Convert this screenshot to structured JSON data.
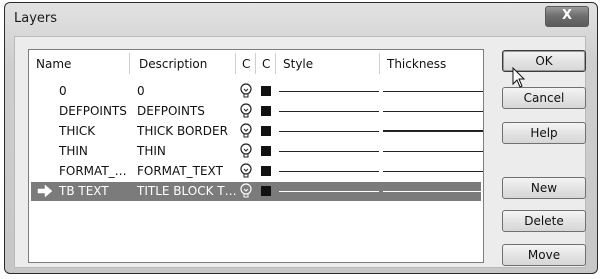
{
  "window": {
    "title": "Layers",
    "close_label": "X"
  },
  "columns": [
    "Name",
    "Description",
    "C",
    "C",
    "Style",
    "Thickness"
  ],
  "rows": [
    {
      "name": "0",
      "description": "0",
      "selected": false,
      "thick": false
    },
    {
      "name": "DEFPOINTS",
      "description": "DEFPOINTS",
      "selected": false,
      "thick": false
    },
    {
      "name": "THICK",
      "description": "THICK BORDER",
      "selected": false,
      "thick": true
    },
    {
      "name": "THIN",
      "description": "THIN",
      "selected": false,
      "thick": false
    },
    {
      "name": "FORMAT_…",
      "description": "FORMAT_TEXT",
      "selected": false,
      "thick": false
    },
    {
      "name": "TB TEXT",
      "description": "TITLE BLOCK T…",
      "selected": true,
      "thick": false
    }
  ],
  "buttons": {
    "ok": "OK",
    "cancel": "Cancel",
    "help": "Help",
    "new": "New",
    "delete": "Delete",
    "move": "Move"
  },
  "icons": {
    "color_column": "lightbulb-icon",
    "swatch": "color-swatch",
    "current_row": "arrow-right-icon"
  }
}
